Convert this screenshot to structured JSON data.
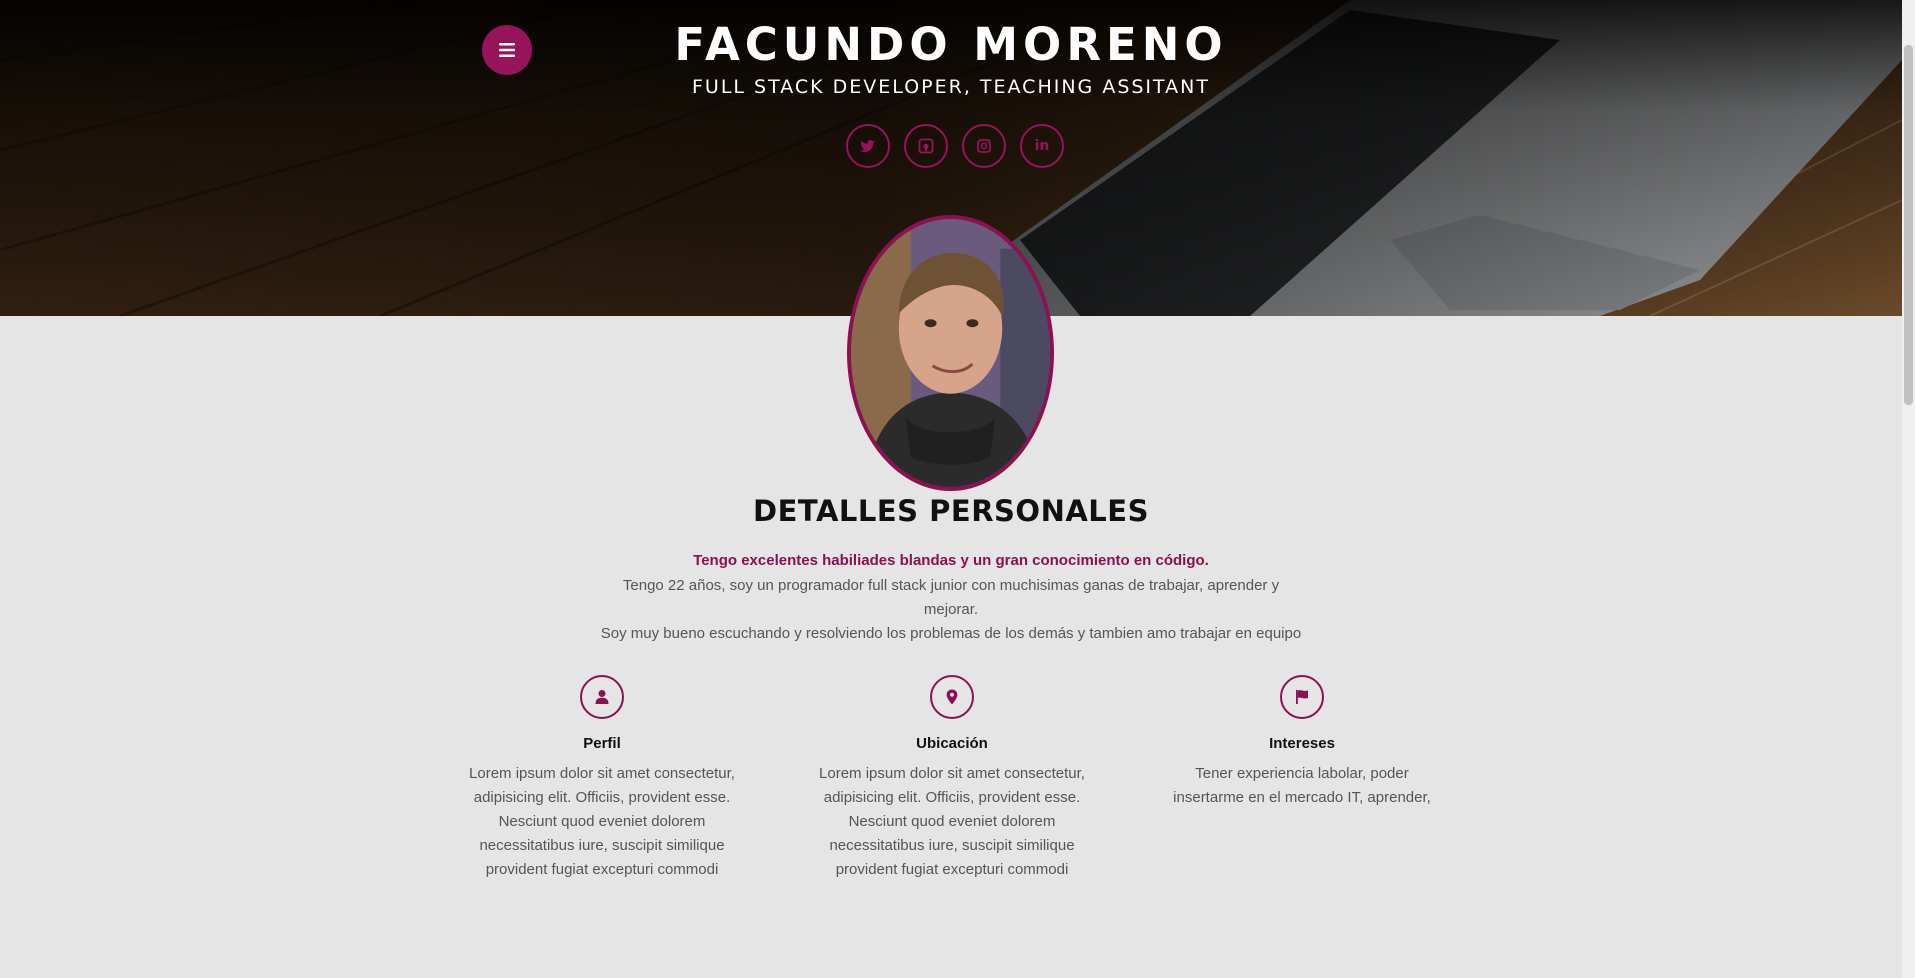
{
  "hero": {
    "title": "FACUNDO MORENO",
    "subtitle": "FULL STACK DEVELOPER, TEACHING ASSITANT",
    "menu_icon": "hamburger-icon",
    "socials": [
      {
        "icon": "twitter-icon",
        "label": ""
      },
      {
        "icon": "github-square-icon",
        "label": ""
      },
      {
        "icon": "instagram-icon",
        "label": ""
      },
      {
        "icon": "linkedin-icon",
        "label": "in"
      }
    ]
  },
  "section": {
    "title": "DETALLES PERSONALES",
    "highlight": "Tengo excelentes habiliades blandas y un gran conocimiento en código.",
    "intro_line1": "Tengo 22 años, soy un programador full stack junior con muchisimas ganas de trabajar, aprender y mejorar.",
    "intro_line2": "Soy muy bueno escuchando y resolviendo los problemas de los demás y tambien amo trabajar en equipo"
  },
  "features": [
    {
      "icon": "user-icon",
      "title": "Perfil",
      "text": "Lorem ipsum dolor sit amet consectetur, adipisicing elit. Officiis, provident esse. Nesciunt quod eveniet dolorem necessitatibus iure, suscipit similique provident fugiat excepturi commodi"
    },
    {
      "icon": "map-marker-icon",
      "title": "Ubicación",
      "text": "Lorem ipsum dolor sit amet consectetur, adipisicing elit. Officiis, provident esse. Nesciunt quod eveniet dolorem necessitatibus iure, suscipit similique provident fugiat excepturi commodi"
    },
    {
      "icon": "flag-icon",
      "title": "Intereses",
      "text": "Tener experiencia labolar, poder insertarme en el mercado IT, aprender,"
    }
  ],
  "colors": {
    "accent": "#8c1052",
    "background": "#e5e5e5",
    "text": "#555555"
  }
}
